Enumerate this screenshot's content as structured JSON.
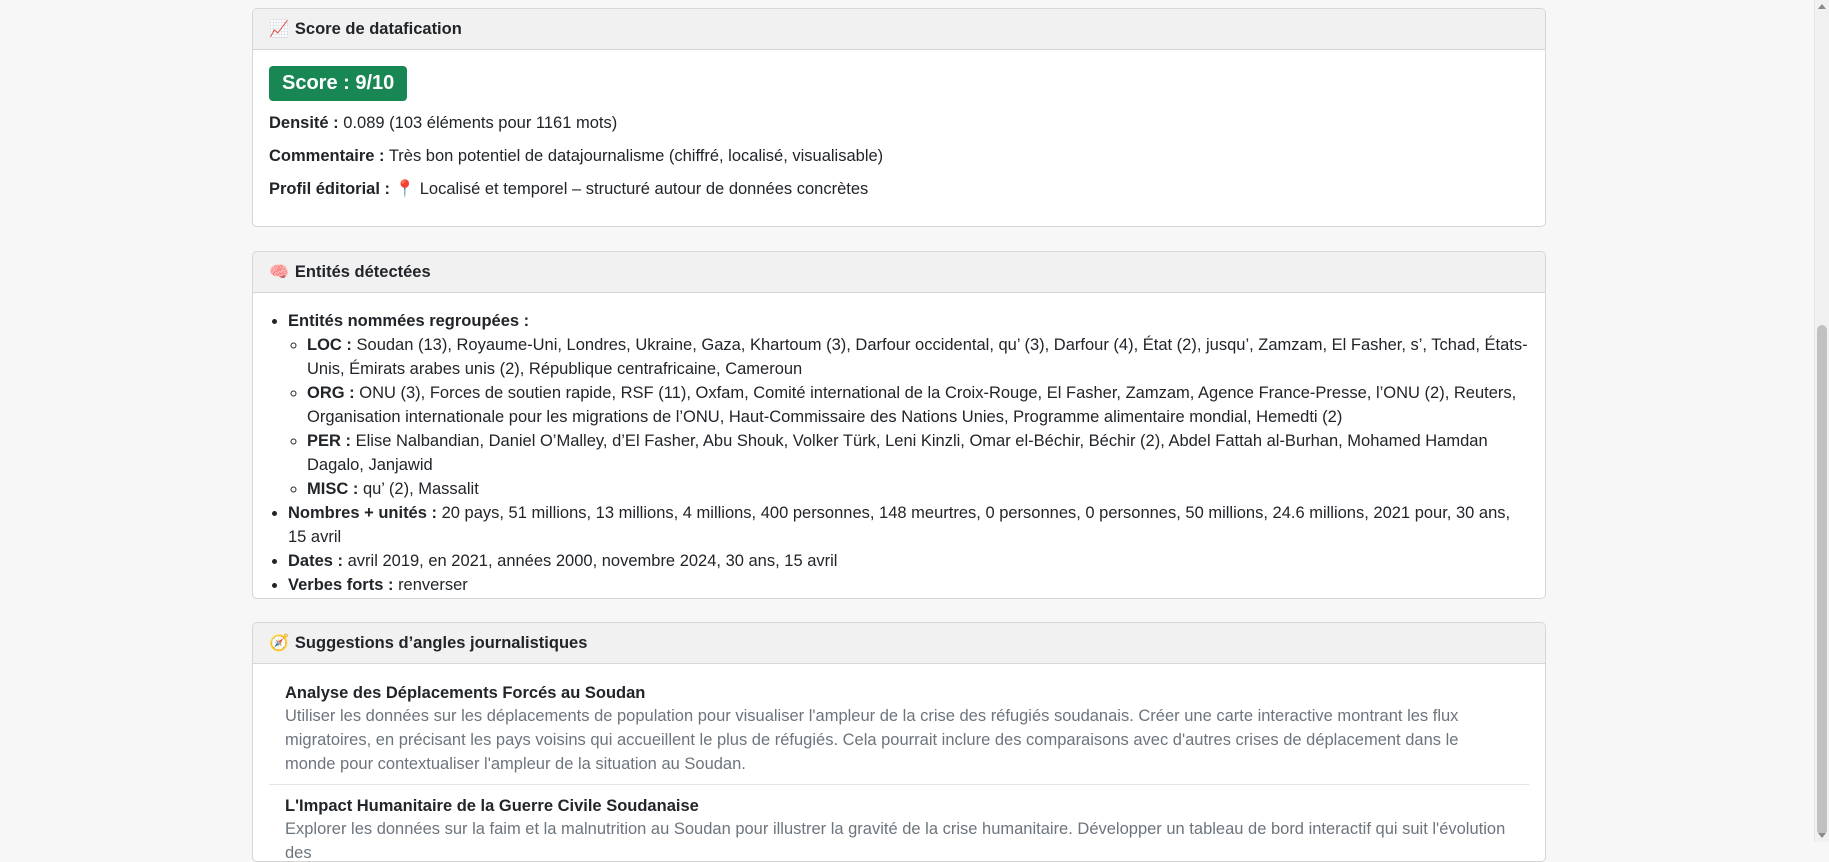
{
  "score_card": {
    "icon": "chart-increasing-icon",
    "title": "Score de datafication",
    "score": "Score : 9/10",
    "density_label": "Densité :",
    "density_value": "0.089 (103 éléments pour 1161 mots)",
    "comment_label": "Commentaire :",
    "comment_value": "Très bon potentiel de datajournalisme (chiffré, localisé, visualisable)",
    "profile_label": "Profil éditorial :",
    "profile_value": "📍 Localisé et temporel – structuré autour de données concrètes"
  },
  "entities_card": {
    "icon": "brain-icon",
    "title": "Entités détectées",
    "grouped_label": "Entités nommées regroupées :",
    "groups": [
      {
        "label": "LOC :",
        "value": "Soudan (13), Royaume-Uni, Londres, Ukraine, Gaza, Khartoum (3), Darfour occidental, qu’ (3), Darfour (4), État (2), jusqu’, Zamzam, El Fasher, s’, Tchad, États-Unis, Émirats arabes unis (2), République centrafricaine, Cameroun"
      },
      {
        "label": "ORG :",
        "value": "ONU (3), Forces de soutien rapide, RSF (11), Oxfam, Comité international de la Croix-Rouge, El Fasher, Zamzam, Agence France-Presse, l’ONU (2), Reuters, Organisation internationale pour les migrations de l’ONU, Haut-Commissaire des Nations Unies, Programme alimentaire mondial, Hemedti (2)"
      },
      {
        "label": "PER :",
        "value": "Elise Nalbandian, Daniel O’Malley, d’El Fasher, Abu Shouk, Volker Türk, Leni Kinzli, Omar el-Béchir, Béchir (2), Abdel Fattah al-Burhan, Mohamed Hamdan Dagalo, Janjawid"
      },
      {
        "label": "MISC :",
        "value": "qu’ (2), Massalit"
      }
    ],
    "numbers_label": "Nombres + unités :",
    "numbers_value": "20 pays, 51 millions, 13 millions, 4 millions, 400 personnes, 148 meurtres, 0 personnes, 0 personnes, 50 millions, 24.6 millions, 2021 pour, 30 ans, 15 avril",
    "dates_label": "Dates :",
    "dates_value": "avril 2019, en 2021, années 2000, novembre 2024, 30 ans, 15 avril",
    "verbs_label": "Verbes forts :",
    "verbs_value": "renverser"
  },
  "angles_card": {
    "icon": "compass-icon",
    "title": "Suggestions d’angles journalistiques",
    "items": [
      {
        "title": "Analyse des Déplacements Forcés au Soudan",
        "description": "Utiliser les données sur les déplacements de population pour visualiser l'ampleur de la crise des réfugiés soudanais. Créer une carte interactive montrant les flux migratoires, en précisant les pays voisins qui accueillent le plus de réfugiés. Cela pourrait inclure des comparaisons avec d'autres crises de déplacement dans le monde pour contextualiser l'ampleur de la situation au Soudan."
      },
      {
        "title": "L'Impact Humanitaire de la Guerre Civile Soudanaise",
        "description": "Explorer les données sur la faim et la malnutrition au Soudan pour illustrer la gravité de la crise humanitaire. Développer un tableau de bord interactif qui suit l'évolution des"
      }
    ]
  }
}
